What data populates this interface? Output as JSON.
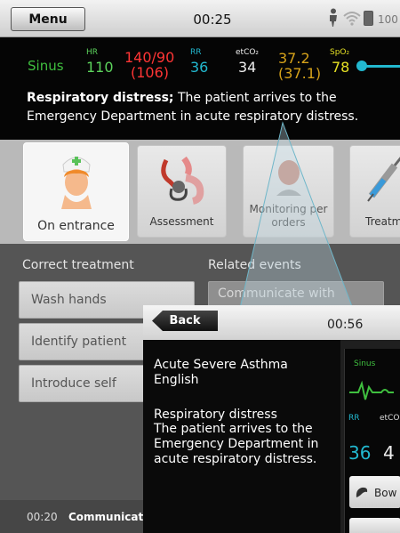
{
  "colors": {
    "hr": "#5cd35c",
    "bp": "#ff3535",
    "rr": "#22b8cf",
    "etco2_secondary": "#d6a21a",
    "spo2": "#e5e024"
  },
  "topbar": {
    "menu_label": "Menu",
    "time": "00:25",
    "battery": "100 %",
    "icons": [
      "person-icon",
      "wifi-icon",
      "battery-icon"
    ]
  },
  "vitals": {
    "rhythm": "Sinus",
    "hr_label": "HR",
    "hr": "110",
    "bp": "140/90",
    "bp_mean": "(106)",
    "rr_label": "RR",
    "rr": "36",
    "etco2_label": "etCO₂",
    "etco2": "34",
    "etco2_secondary": "37.2",
    "etco2_secondary_sub": "(37.1)",
    "spo2_label": "SpO₂",
    "spo2": "78"
  },
  "scenario": {
    "title": "Respiratory distress;",
    "text": " The patient arrives to the Emergency Department in acute respiratory distress."
  },
  "tabs": [
    {
      "label": "On entrance",
      "icon": "nurse-icon"
    },
    {
      "label": "Assessment",
      "icon": "stethoscope-icon"
    },
    {
      "label": "Monitoring per orders",
      "icon": "monitoring-icon"
    },
    {
      "label": "Treatment",
      "icon": "syringe-icon"
    }
  ],
  "content": {
    "correct_heading": "Correct treatment",
    "related_heading": "Related events",
    "actions": [
      "Wash hands",
      "Identify patient",
      "Introduce self"
    ],
    "related_event": "Communicate with"
  },
  "log": {
    "time": "00:20",
    "text": "Communicat"
  },
  "inset": {
    "back_label": "Back",
    "time": "00:56",
    "case_title": "Acute Severe Asthma",
    "language": "English",
    "event_title": "Respiratory distress",
    "event_text": "The patient arrives to the Emergency Department in acute respiratory distress.",
    "monitor": {
      "rhythm": "Sinus",
      "rr_label": "RR",
      "etco2_label": "etCO",
      "rr": "36",
      "etco2": "4",
      "bowel_label": "Bow"
    }
  }
}
